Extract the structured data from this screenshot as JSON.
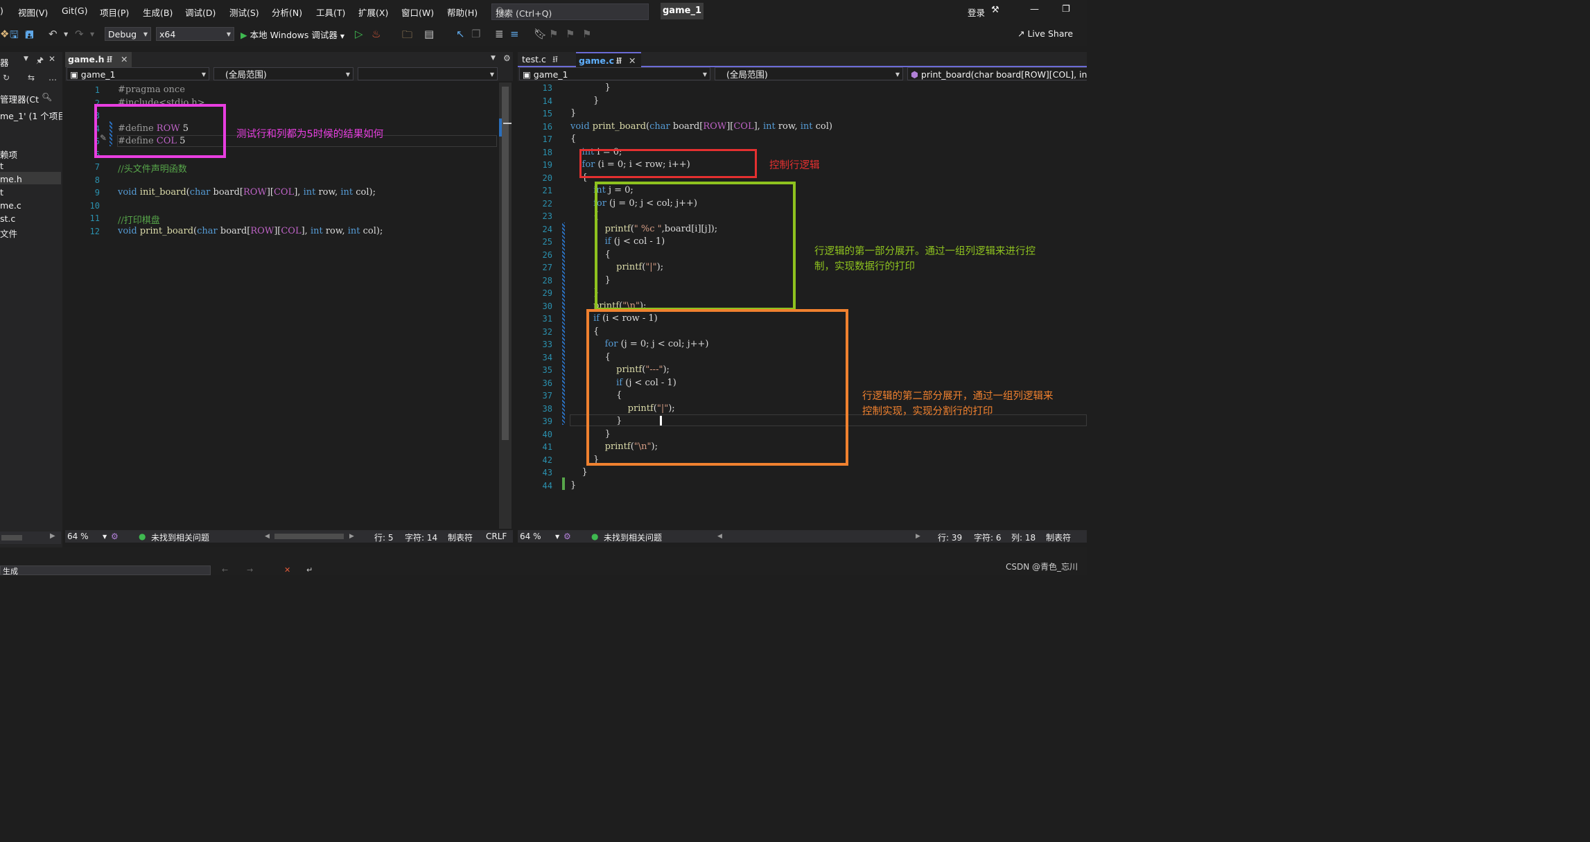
{
  "menubar": {
    "items": [
      ")",
      "视图(V)",
      "Git(G)",
      "项目(P)",
      "生成(B)",
      "调试(D)",
      "测试(S)",
      "分析(N)",
      "工具(T)",
      "扩展(X)",
      "窗口(W)",
      "帮助(H)"
    ],
    "search_placeholder": "搜索 (Ctrl+Q)",
    "window_title": "game_1",
    "login": "登录"
  },
  "toolbar": {
    "config": "Debug",
    "platform": "x64",
    "run_label": "本地 Windows 调试器",
    "live_share": "Live Share"
  },
  "solution_panel": {
    "title": "器",
    "manager": "管理器(Ct",
    "solution": "me_1' (1 个项目",
    "items": [
      "赖项",
      "t",
      "me.h",
      "t",
      "me.c",
      "st.c",
      "文件"
    ]
  },
  "left_editor": {
    "tab": "game.h",
    "nav_project": "game_1",
    "nav_scope": "(全局范围)",
    "lines": [
      {
        "n": "1",
        "html": "<span class=\"pp\">#pragma once</span>"
      },
      {
        "n": "2",
        "html": "<span class=\"pp\">#include&lt;stdio.h&gt;</span>"
      },
      {
        "n": "3",
        "html": ""
      },
      {
        "n": "4",
        "html": "<span class=\"pp\">#define </span><span class=\"mac\">ROW</span> 5"
      },
      {
        "n": "5",
        "html": "<span class=\"pp\">#define </span><span class=\"mac\">COL</span> 5"
      },
      {
        "n": "6",
        "html": ""
      },
      {
        "n": "7",
        "html": "<span class=\"cm\">//头文件声明函数</span>"
      },
      {
        "n": "8",
        "html": ""
      },
      {
        "n": "9",
        "html": "<span class=\"kw\">void</span> <span class=\"fn\">init_board</span>(<span class=\"kw\">char</span> board[<span class=\"mac\">ROW</span>][<span class=\"mac\">COL</span>], <span class=\"kw\">int</span> row, <span class=\"kw\">int</span> col);"
      },
      {
        "n": "10",
        "html": ""
      },
      {
        "n": "11",
        "html": "<span class=\"cm\">//打印棋盘</span>"
      },
      {
        "n": "12",
        "html": "<span class=\"kw\">void</span> <span class=\"fn\">print_board</span>(<span class=\"kw\">char</span> board[<span class=\"mac\">ROW</span>][<span class=\"mac\">COL</span>], <span class=\"kw\">int</span> row, <span class=\"kw\">int</span> col);"
      }
    ],
    "annotation": "测试行和列都为5时候的结果如何",
    "status": {
      "zoom": "64 %",
      "issues": "未找到相关问题",
      "line": "行: 5",
      "char": "字符: 14",
      "tab": "制表符",
      "eol": "CRLF"
    }
  },
  "right_editor": {
    "tab_inactive": "test.c",
    "tab_active": "game.c",
    "nav_project": "game_1",
    "nav_scope": "(全局范围)",
    "nav_func": "print_board(char board[ROW][COL], int r",
    "lines": [
      {
        "n": "13",
        "html": "            }"
      },
      {
        "n": "14",
        "html": "        }"
      },
      {
        "n": "15",
        "html": "}"
      },
      {
        "n": "16",
        "html": "<span class=\"kw\">void</span> <span class=\"fn\">print_board</span>(<span class=\"kw\">char</span> board[<span class=\"mac\">ROW</span>][<span class=\"mac\">COL</span>], <span class=\"kw\">int</span> row, <span class=\"kw\">int</span> col)"
      },
      {
        "n": "17",
        "html": "{"
      },
      {
        "n": "18",
        "html": "    <span class=\"kw\">int</span> i = 0;"
      },
      {
        "n": "19",
        "html": "    <span class=\"kw\">for</span> (i = 0; i &lt; row; i++)"
      },
      {
        "n": "20",
        "html": "    {"
      },
      {
        "n": "21",
        "html": "        <span class=\"kw\">int</span> j = 0;"
      },
      {
        "n": "22",
        "html": "        <span class=\"kw\">for</span> (j = 0; j &lt; col; j++)"
      },
      {
        "n": "23",
        "html": "        {"
      },
      {
        "n": "24",
        "html": "            <span class=\"fn\">printf</span>(<span class=\"str\">\" %c \"</span>,board[i][j]);"
      },
      {
        "n": "25",
        "html": "            <span class=\"kw\">if</span> (j &lt; col - 1)"
      },
      {
        "n": "26",
        "html": "            {"
      },
      {
        "n": "27",
        "html": "                <span class=\"fn\">printf</span>(<span class=\"str\">\"|\"</span>);"
      },
      {
        "n": "28",
        "html": "            }"
      },
      {
        "n": "29",
        "html": "        }"
      },
      {
        "n": "30",
        "html": "        <span class=\"fn\">printf</span>(<span class=\"str\">\"\\n\"</span>);"
      },
      {
        "n": "31",
        "html": "        <span class=\"kw\">if</span> (i &lt; row - 1)"
      },
      {
        "n": "32",
        "html": "        {"
      },
      {
        "n": "33",
        "html": "            <span class=\"kw\">for</span> (j = 0; j &lt; col; j++)"
      },
      {
        "n": "34",
        "html": "            {"
      },
      {
        "n": "35",
        "html": "                <span class=\"fn\">printf</span>(<span class=\"str\">\"---\"</span>);"
      },
      {
        "n": "36",
        "html": "                <span class=\"kw\">if</span> (j &lt; col - 1)"
      },
      {
        "n": "37",
        "html": "                {"
      },
      {
        "n": "38",
        "html": "                    <span class=\"fn\">printf</span>(<span class=\"str\">\"|\"</span>);"
      },
      {
        "n": "39",
        "html": "                }"
      },
      {
        "n": "40",
        "html": "            }"
      },
      {
        "n": "41",
        "html": "            <span class=\"fn\">printf</span>(<span class=\"str\">\"\\n\"</span>);"
      },
      {
        "n": "42",
        "html": "        }"
      },
      {
        "n": "43",
        "html": "    }"
      },
      {
        "n": "44",
        "html": "}"
      }
    ],
    "annotations": {
      "row_logic": "控制行逻辑",
      "part1_a": "行逻辑的第一部分展开。通过一组列逻辑来进行控",
      "part1_b": "制，实现数据行的打印",
      "part2_a": "行逻辑的第二部分展开，通过一组列逻辑来",
      "part2_b": "控制实现，实现分割行的打印"
    },
    "status": {
      "zoom": "64 %",
      "issues": "未找到相关问题",
      "line": "行: 39",
      "char": "字符: 6",
      "col": "列: 18",
      "tab": "制表符"
    }
  },
  "bottom": {
    "output_label": "生成",
    "watermark": "CSDN @青色_忘川"
  },
  "colors": {
    "magenta": "#e83ee0",
    "red": "#e53030",
    "green": "#8ec21f",
    "orange": "#f0812f"
  }
}
